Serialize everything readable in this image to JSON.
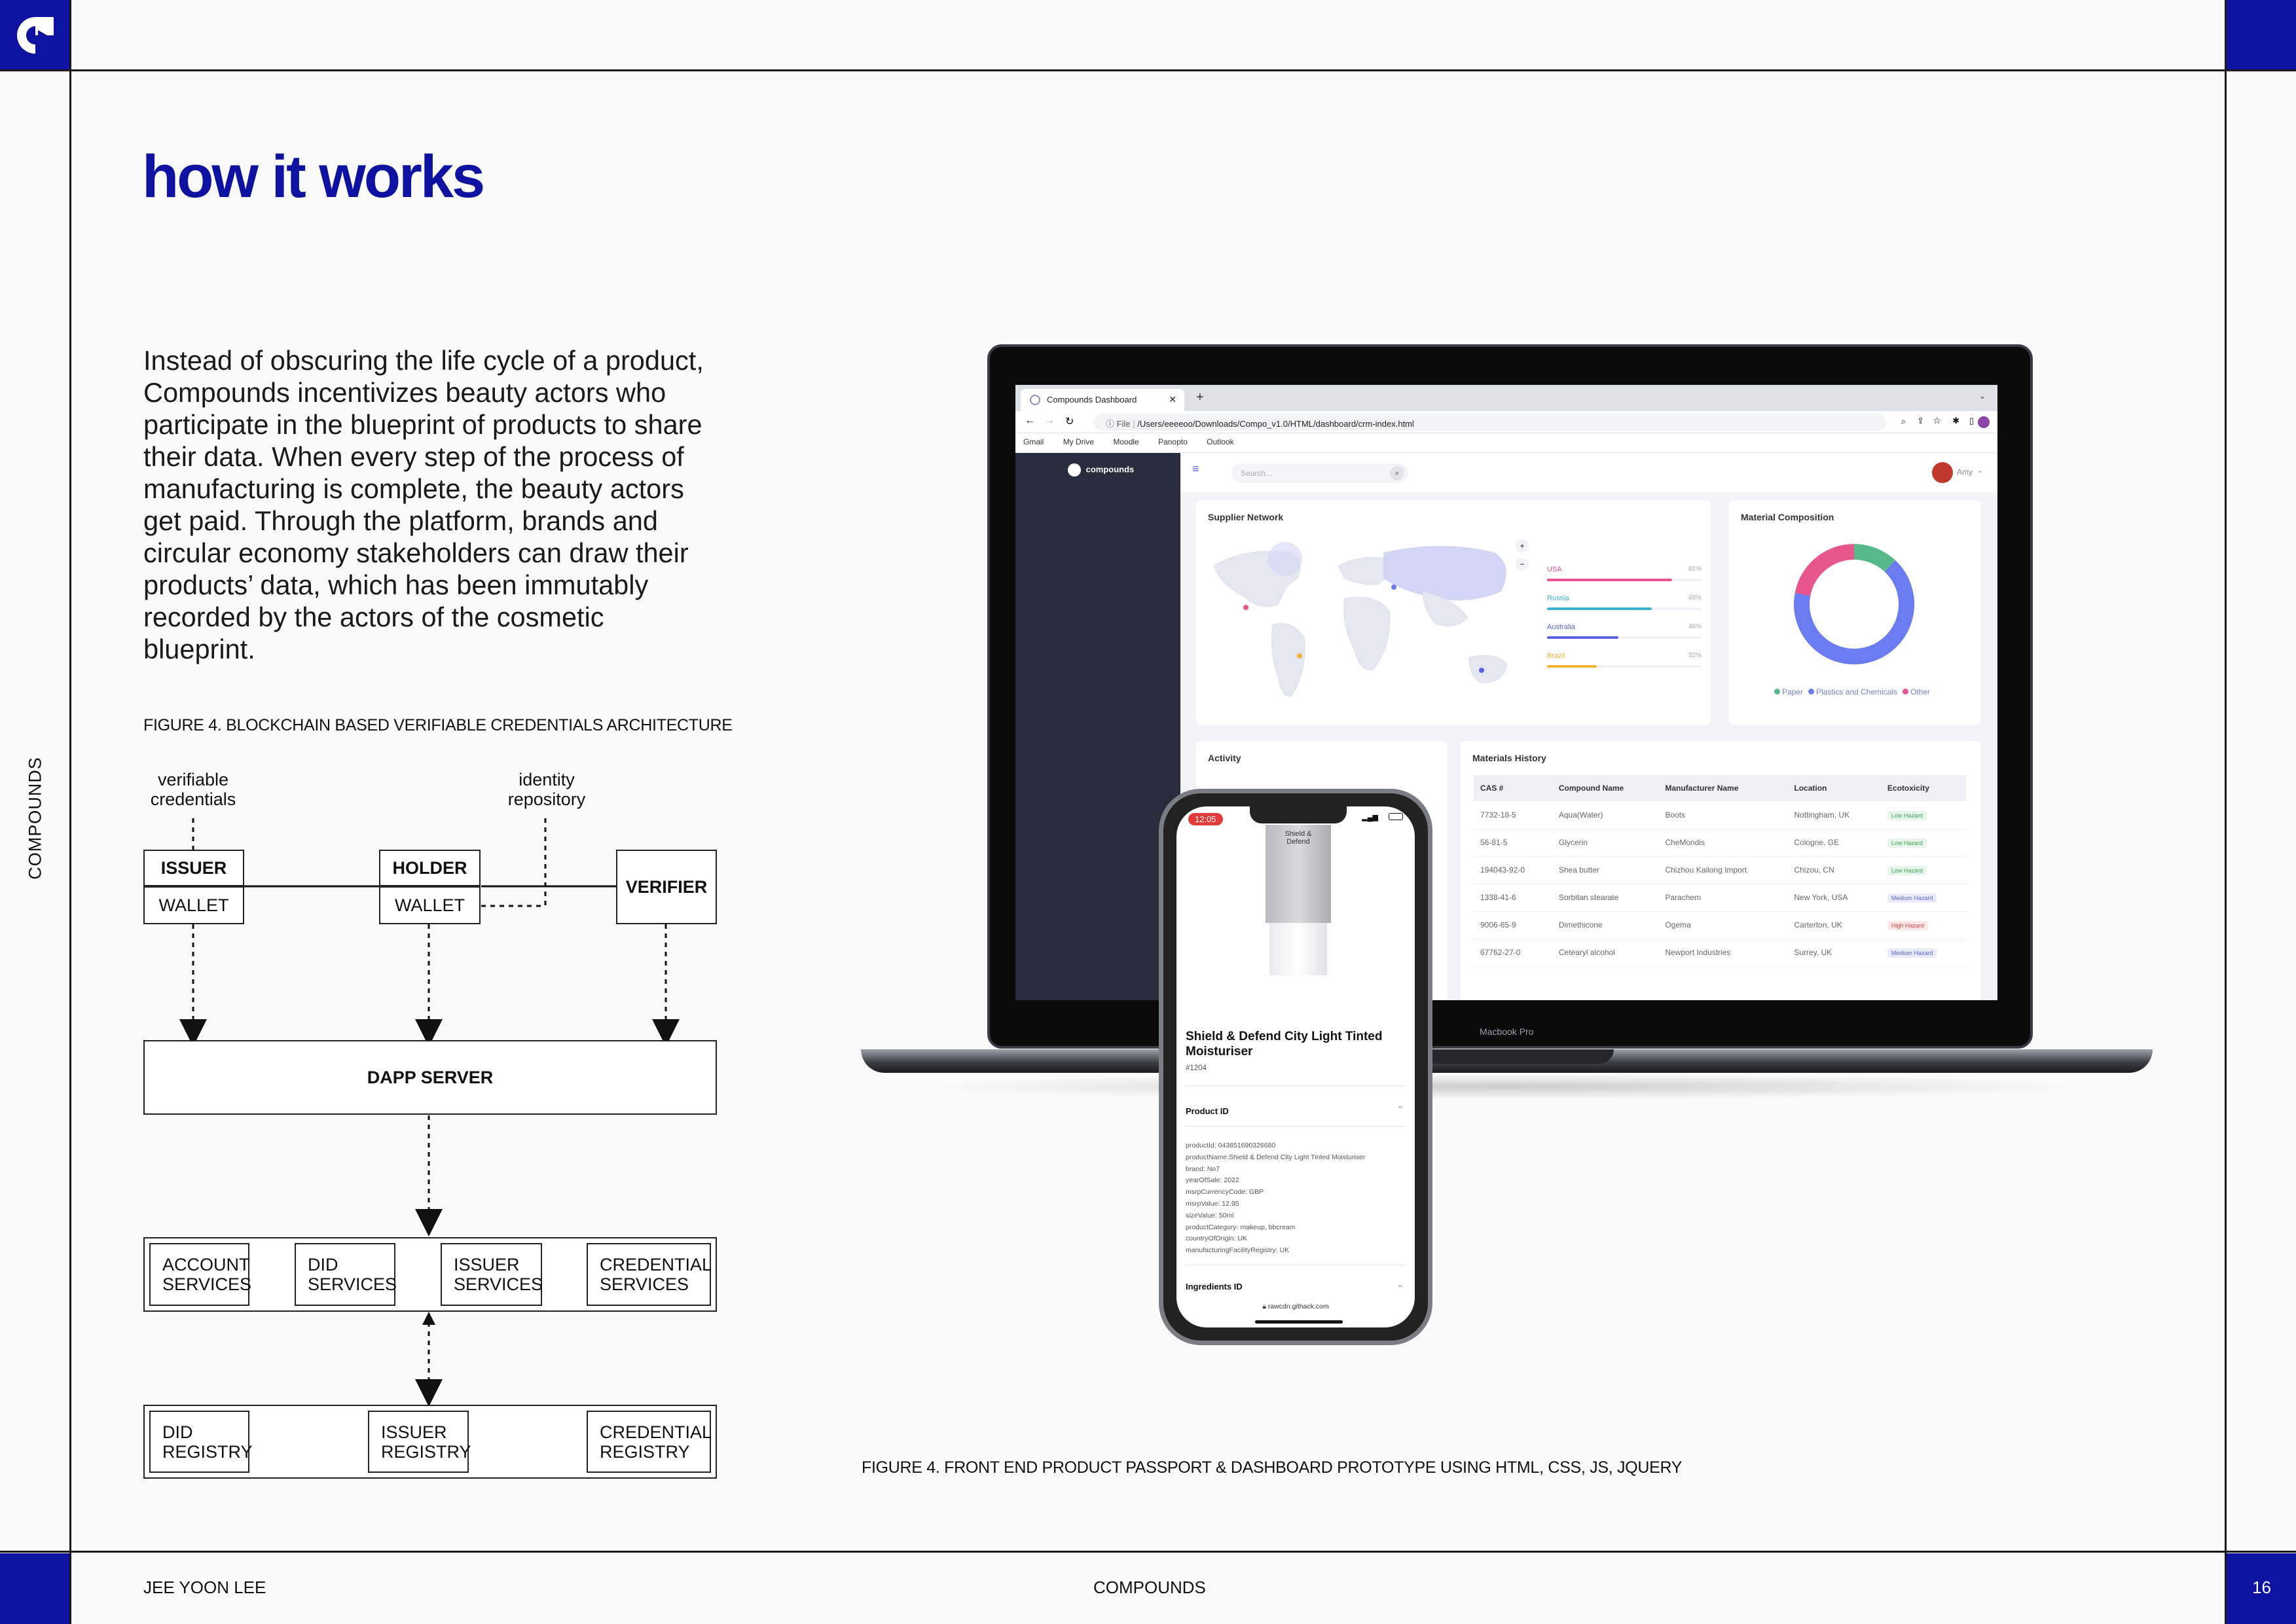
{
  "header": {
    "brand_icon": "compounds-logo-icon"
  },
  "side_label": "COMPOUNDS",
  "title": "how it works",
  "intro": "Instead of obscuring the life cycle of a product, Compounds incentivizes beauty actors who participate in the blueprint of products to share their data. When every step of the process of manufacturing is complete, the beauty actors get paid. Through the platform, brands and circular economy stakeholders can draw their products’ data, which has been immutably recorded by the actors of the cosmetic blueprint.",
  "figure_left": {
    "caption": "FIGURE 4. BLOCKCHAIN BASED VERIFIABLE CREDENTIALS ARCHITECTURE",
    "labels": {
      "vc_line1": "verifiable",
      "vc_line2": "credentials",
      "id_line1": "identity",
      "id_line2": "repository"
    },
    "issuer": "ISSUER",
    "holder": "HOLDER",
    "wallet": "WALLET",
    "verifier": "VERIFIER",
    "dapp": "DAPP SERVER",
    "services": [
      {
        "l1": "ACCOUNT",
        "l2": "SERVICES"
      },
      {
        "l1": "DID",
        "l2": "SERVICES"
      },
      {
        "l1": "ISSUER",
        "l2": "SERVICES"
      },
      {
        "l1": "CREDENTIAL",
        "l2": "SERVICES"
      }
    ],
    "registries": [
      {
        "l1": "DID",
        "l2": "REGISTRY"
      },
      {
        "l1": "ISSUER",
        "l2": "REGISTRY"
      },
      {
        "l1": "CREDENTIAL",
        "l2": "REGISTRY"
      }
    ]
  },
  "figure_right": {
    "caption": "FIGURE 4. FRONT END PRODUCT PASSPORT & DASHBOARD PROTOTYPE USING HTML, CSS, JS, JQUERY",
    "laptop_label": "Macbook Pro",
    "browser": {
      "tab_title": "Compounds Dashboard",
      "url": "/Users/eeeeoo/Downloads/Compo_v1.0/HTML/dashboard/crm-index.html",
      "url_prefix": "File",
      "bookmarks": [
        "Gmail",
        "My Drive",
        "Moodle",
        "Panopto",
        "Outlook"
      ]
    },
    "dashboard": {
      "brand": "compounds",
      "search_placeholder": "Search...",
      "user": "Amy",
      "supplier_network": {
        "title": "Supplier Network",
        "rows": [
          {
            "name": "USA",
            "pct": "81%",
            "value": 0.81,
            "color": "#e8558e"
          },
          {
            "name": "Russia",
            "pct": "68%",
            "value": 0.68,
            "color": "#3bb3d0"
          },
          {
            "name": "Australia",
            "pct": "46%",
            "value": 0.46,
            "color": "#5b63e0"
          },
          {
            "name": "Brazil",
            "pct": "32%",
            "value": 0.32,
            "color": "#f3b23a"
          }
        ]
      },
      "material_composition": {
        "title": "Material Composition",
        "legend": [
          {
            "name": "Paper",
            "color": "#57b98a",
            "value": 0.12
          },
          {
            "name": "Plastics and Chemicals",
            "color": "#6b7cf0",
            "value": 0.66
          },
          {
            "name": "Other",
            "color": "#e8558e",
            "value": 0.22
          }
        ]
      },
      "activity_title": "Activity",
      "materials_history": {
        "title": "Materials History",
        "columns": [
          "CAS #",
          "Compound Name",
          "Manufacturer Name",
          "Location",
          "Ecotoxicity"
        ],
        "rows": [
          [
            "7732-18-5",
            "Aqua(Water)",
            "Boots",
            "Nottingham, UK",
            "Low Hazard"
          ],
          [
            "56-81-5",
            "Glycerin",
            "CheMondis",
            "Cologne, GE",
            "Low Hazard"
          ],
          [
            "194043-92-0",
            "Shea butter",
            "Chizhou Kailong Import",
            "Chizou, CN",
            "Low Hazard"
          ],
          [
            "1338-41-6",
            "Sorbitan stearate",
            "Parachem",
            "New York, USA",
            "Medium Hazard"
          ],
          [
            "9006-65-9",
            "Dimethicone",
            "Ogema",
            "Carterton, UK",
            "High Hazard"
          ],
          [
            "67762-27-0",
            "Cetearyl alcohol",
            "Newport Industries",
            "Surrey, UK",
            "Medium Hazard"
          ]
        ]
      }
    },
    "phone": {
      "time": "12:05",
      "tube_text1": "Shield &",
      "tube_text2": "Defend",
      "product_title": "Shield & Defend City Light Tinted Moisturiser",
      "product_code": "#1204",
      "section_product": "Product ID",
      "props": [
        "productId: 043851690326680",
        "productName:Shield & Defend City Light Tinted Moisturiser",
        "brand: No7",
        "yearOfSale: 2022",
        "msrpCurrencyCode: GBP",
        "msrpValue: 12.95",
        "sizeValue: 50ml",
        "productCategory: makeup, bbcream",
        "countryOfOrigin: UK",
        "manufacturingFacilityRegistry: UK"
      ],
      "section_ingredients": "Ingredients ID",
      "url": "rawcdn.githack.com"
    }
  },
  "footer": {
    "name": "JEE YOON LEE",
    "center": "COMPOUNDS",
    "page": "16"
  }
}
